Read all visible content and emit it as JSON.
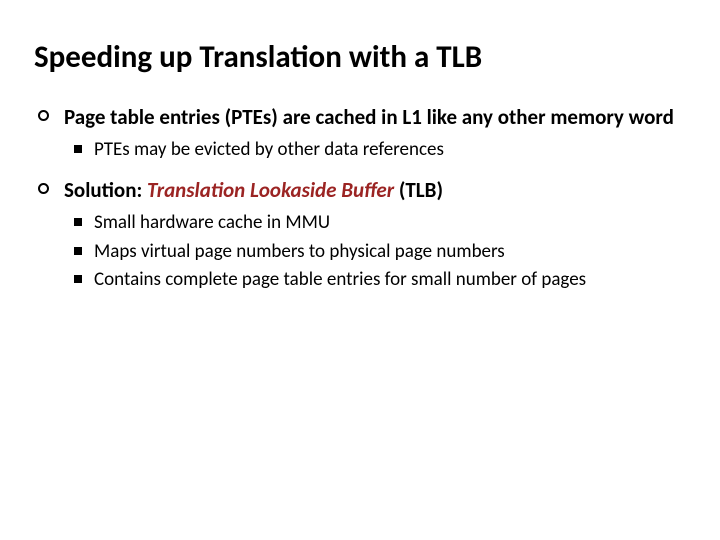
{
  "title": "Speeding up Translation with a TLB",
  "bullets": {
    "b1": {
      "text": "Page table entries (PTEs) are cached in L1 like any other memory word",
      "sub": {
        "s1": "PTEs may be evicted by other data references"
      }
    },
    "b2": {
      "prefix": "Solution: ",
      "em": "Translation Lookaside Buffer",
      "suffix": " (TLB)",
      "sub": {
        "s1": "Small hardware cache in MMU",
        "s2": "Maps virtual page numbers to physical page numbers",
        "s3": "Contains complete page table entries for small number of pages"
      }
    }
  }
}
